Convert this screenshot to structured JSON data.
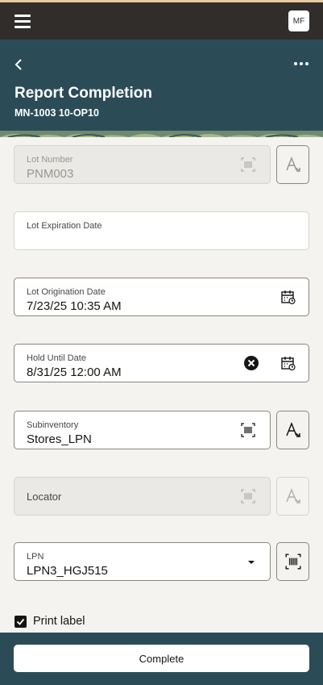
{
  "topbar": {
    "avatar_initials": "MF"
  },
  "header": {
    "title": "Report Completion",
    "subtitle": "MN-1003 10-OP10"
  },
  "form": {
    "lot_number": {
      "label": "Lot Number",
      "value": "PNM003"
    },
    "lot_expiration_date": {
      "label": "Lot Expiration Date",
      "value": ""
    },
    "lot_origination_date": {
      "label": "Lot Origination Date",
      "value": "7/23/25 10:35 AM"
    },
    "hold_until_date": {
      "label": "Hold Until Date",
      "value": "8/31/25 12:00 AM"
    },
    "subinventory": {
      "label": "Subinventory",
      "value": "Stores_LPN"
    },
    "locator": {
      "label": "Locator",
      "value": ""
    },
    "lpn": {
      "label": "LPN",
      "value": "LPN3_HGJ515"
    }
  },
  "print_label": {
    "label": "Print label",
    "checked": true
  },
  "footer": {
    "complete_label": "Complete"
  },
  "colors": {
    "topbar": "#312d2a",
    "header": "#2b4c57",
    "page_bg": "#f5f3ef"
  }
}
